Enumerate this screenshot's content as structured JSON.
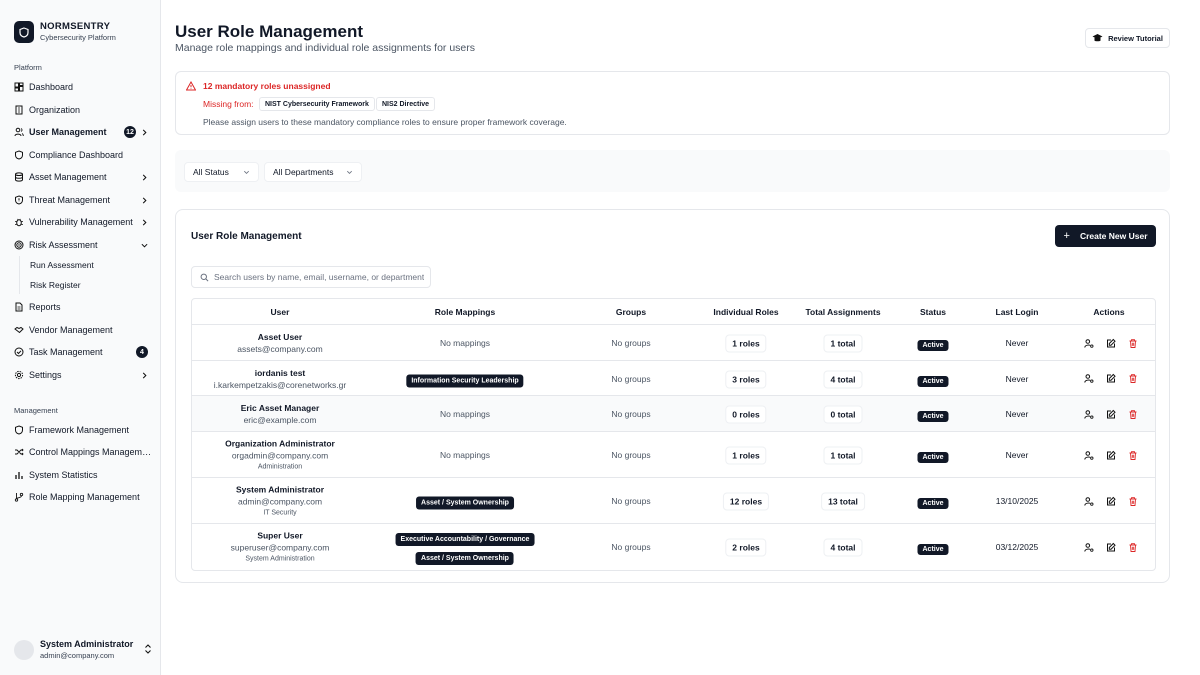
{
  "brand": {
    "name": "NORMSENTRY",
    "subtitle": "Cybersecurity Platform"
  },
  "sidebar": {
    "platform_label": "Platform",
    "management_label": "Management",
    "platform_items": [
      {
        "label": "Dashboard",
        "icon": "layout-dashboard-icon"
      },
      {
        "label": "Organization",
        "icon": "building-icon"
      },
      {
        "label": "User Management",
        "icon": "users-icon",
        "badge": "12",
        "active": true
      },
      {
        "label": "Compliance Dashboard",
        "icon": "shield-icon"
      },
      {
        "label": "Asset Management",
        "icon": "database-icon"
      },
      {
        "label": "Threat Management",
        "icon": "shield-alert-icon"
      },
      {
        "label": "Vulnerability Management",
        "icon": "bug-icon"
      },
      {
        "label": "Risk Assessment",
        "icon": "target-icon"
      },
      {
        "label": "Reports",
        "icon": "file-text-icon"
      },
      {
        "label": "Vendor Management",
        "icon": "handshake-icon"
      },
      {
        "label": "Task Management",
        "icon": "check-circle-icon",
        "badge": "4"
      },
      {
        "label": "Settings",
        "icon": "gear-icon"
      }
    ],
    "risk_sub_items": [
      "Run Assessment",
      "Risk Register"
    ],
    "management_items": [
      {
        "label": "Framework Management",
        "icon": "shield-icon"
      },
      {
        "label": "Control Mappings Management",
        "icon": "shuffle-icon"
      },
      {
        "label": "System Statistics",
        "icon": "bar-chart-icon"
      },
      {
        "label": "Role Mapping Management",
        "icon": "git-branch-icon"
      }
    ],
    "profile": {
      "name": "System Administrator",
      "email": "admin@company.com"
    }
  },
  "header": {
    "title": "User Role Management",
    "subtitle": "Manage role mappings and individual role assignments for users",
    "tutorial_label": "Review Tutorial"
  },
  "alert": {
    "title": "12 mandatory roles unassigned",
    "missing_label": "Missing from:",
    "frameworks": [
      "NIST Cybersecurity Framework",
      "NIS2 Directive"
    ],
    "description": "Please assign users to these mandatory compliance roles to ensure proper framework coverage."
  },
  "filters": {
    "status": "All Status",
    "department": "All Departments"
  },
  "card": {
    "title": "User Role Management",
    "create_label": "Create New User",
    "search_placeholder": "Search users by name, email, username, or department..."
  },
  "table": {
    "headers": [
      "User",
      "Role Mappings",
      "Groups",
      "Individual Roles",
      "Total Assignments",
      "Status",
      "Last Login",
      "Actions"
    ],
    "rows": [
      {
        "name": "Asset User",
        "email": "assets@company.com",
        "dept": "",
        "mappings": [],
        "mappings_empty": "No mappings",
        "groups": "No groups",
        "roles": "1 roles",
        "total": "1 total",
        "status": "Active",
        "last_login": "Never"
      },
      {
        "name": "iordanis test",
        "email": "i.karkempetzakis@corenetworks.gr",
        "dept": "",
        "mappings": [
          "Information Security Leadership"
        ],
        "mappings_empty": "",
        "groups": "No groups",
        "roles": "3 roles",
        "total": "4 total",
        "status": "Active",
        "last_login": "Never"
      },
      {
        "name": "Eric Asset Manager",
        "email": "eric@example.com",
        "dept": "",
        "mappings": [],
        "mappings_empty": "No mappings",
        "groups": "No groups",
        "roles": "0 roles",
        "total": "0 total",
        "status": "Active",
        "last_login": "Never"
      },
      {
        "name": "Organization Administrator",
        "email": "orgadmin@company.com",
        "dept": "Administration",
        "mappings": [],
        "mappings_empty": "No mappings",
        "groups": "No groups",
        "roles": "1 roles",
        "total": "1 total",
        "status": "Active",
        "last_login": "Never"
      },
      {
        "name": "System Administrator",
        "email": "admin@company.com",
        "dept": "IT Security",
        "mappings": [
          "Asset / System Ownership"
        ],
        "mappings_empty": "",
        "groups": "No groups",
        "roles": "12 roles",
        "total": "13 total",
        "status": "Active",
        "last_login": "13/10/2025"
      },
      {
        "name": "Super User",
        "email": "superuser@company.com",
        "dept": "System Administration",
        "mappings": [
          "Executive Accountability / Governance",
          "Asset / System Ownership"
        ],
        "mappings_empty": "",
        "groups": "No groups",
        "roles": "2 roles",
        "total": "4 total",
        "status": "Active",
        "last_login": "03/12/2025"
      }
    ]
  },
  "colors": {
    "accent": "#111827",
    "alert": "#dc2626",
    "delete": "#dc2626",
    "border": "#e5e7eb"
  }
}
